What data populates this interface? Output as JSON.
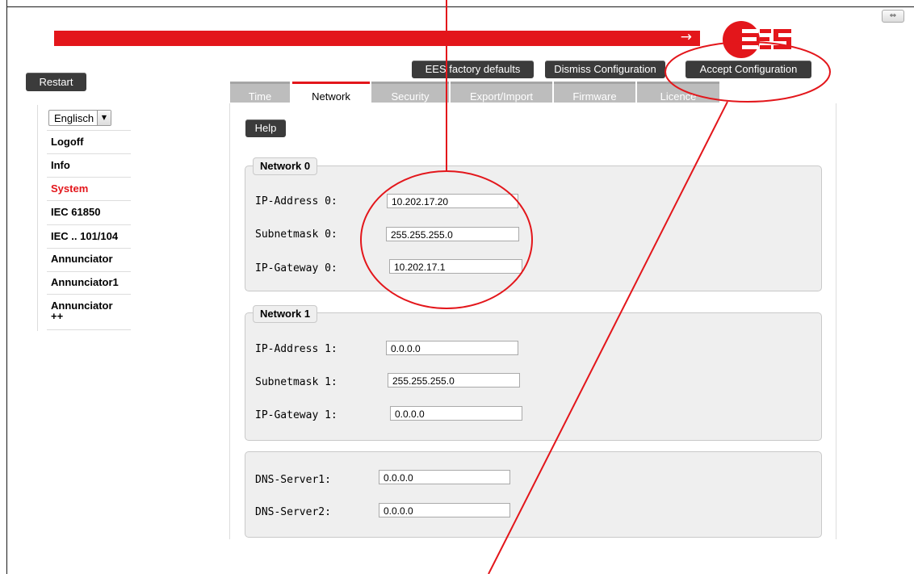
{
  "window": {
    "resize_glyph": "⇔"
  },
  "banner": {
    "arrow": "→",
    "logo_text": "EES"
  },
  "toolbar": {
    "factory_defaults_label": "EES factory defaults",
    "dismiss_label": "Dismiss Configuration",
    "accept_label": "Accept Configuration"
  },
  "restart_label": "Restart",
  "sidebar": {
    "language": "Englisch",
    "items": [
      {
        "label": "Logoff",
        "active": false
      },
      {
        "label": "Info",
        "active": false
      },
      {
        "label": "System",
        "active": true
      },
      {
        "label": "IEC 61850",
        "active": false
      },
      {
        "label": "IEC .. 101/104",
        "active": false
      },
      {
        "label": "Annunciator",
        "active": false
      },
      {
        "label": "Annunciator1",
        "active": false
      },
      {
        "label": "Annunciator ++",
        "active": false
      }
    ]
  },
  "tabs": [
    {
      "label": "Time",
      "active": false
    },
    {
      "label": "Network",
      "active": true
    },
    {
      "label": "Security",
      "active": false
    },
    {
      "label": "Export/Import",
      "active": false
    },
    {
      "label": "Firmware",
      "active": false
    },
    {
      "label": "Licence",
      "active": false
    }
  ],
  "help_label": "Help",
  "network0": {
    "legend": "Network 0",
    "ip_label": "IP-Address 0:",
    "ip_value": "10.202.17.20",
    "mask_label": "Subnetmask 0:",
    "mask_value": "255.255.255.0",
    "gw_label": "IP-Gateway 0:",
    "gw_value": "10.202.17.1"
  },
  "network1": {
    "legend": "Network 1",
    "ip_label": "IP-Address 1:",
    "ip_value": "0.0.0.0",
    "mask_label": "Subnetmask 1:",
    "mask_value": "255.255.255.0",
    "gw_label": "IP-Gateway 1:",
    "gw_value": "0.0.0.0"
  },
  "dns": {
    "dns1_label": "DNS-Server1:",
    "dns1_value": "0.0.0.0",
    "dns2_label": "DNS-Server2:",
    "dns2_value": "0.0.0.0"
  },
  "colors": {
    "brand_red": "#e3161b",
    "dark_button": "#3b3b3b",
    "tab_inactive": "#bdbdbd"
  }
}
